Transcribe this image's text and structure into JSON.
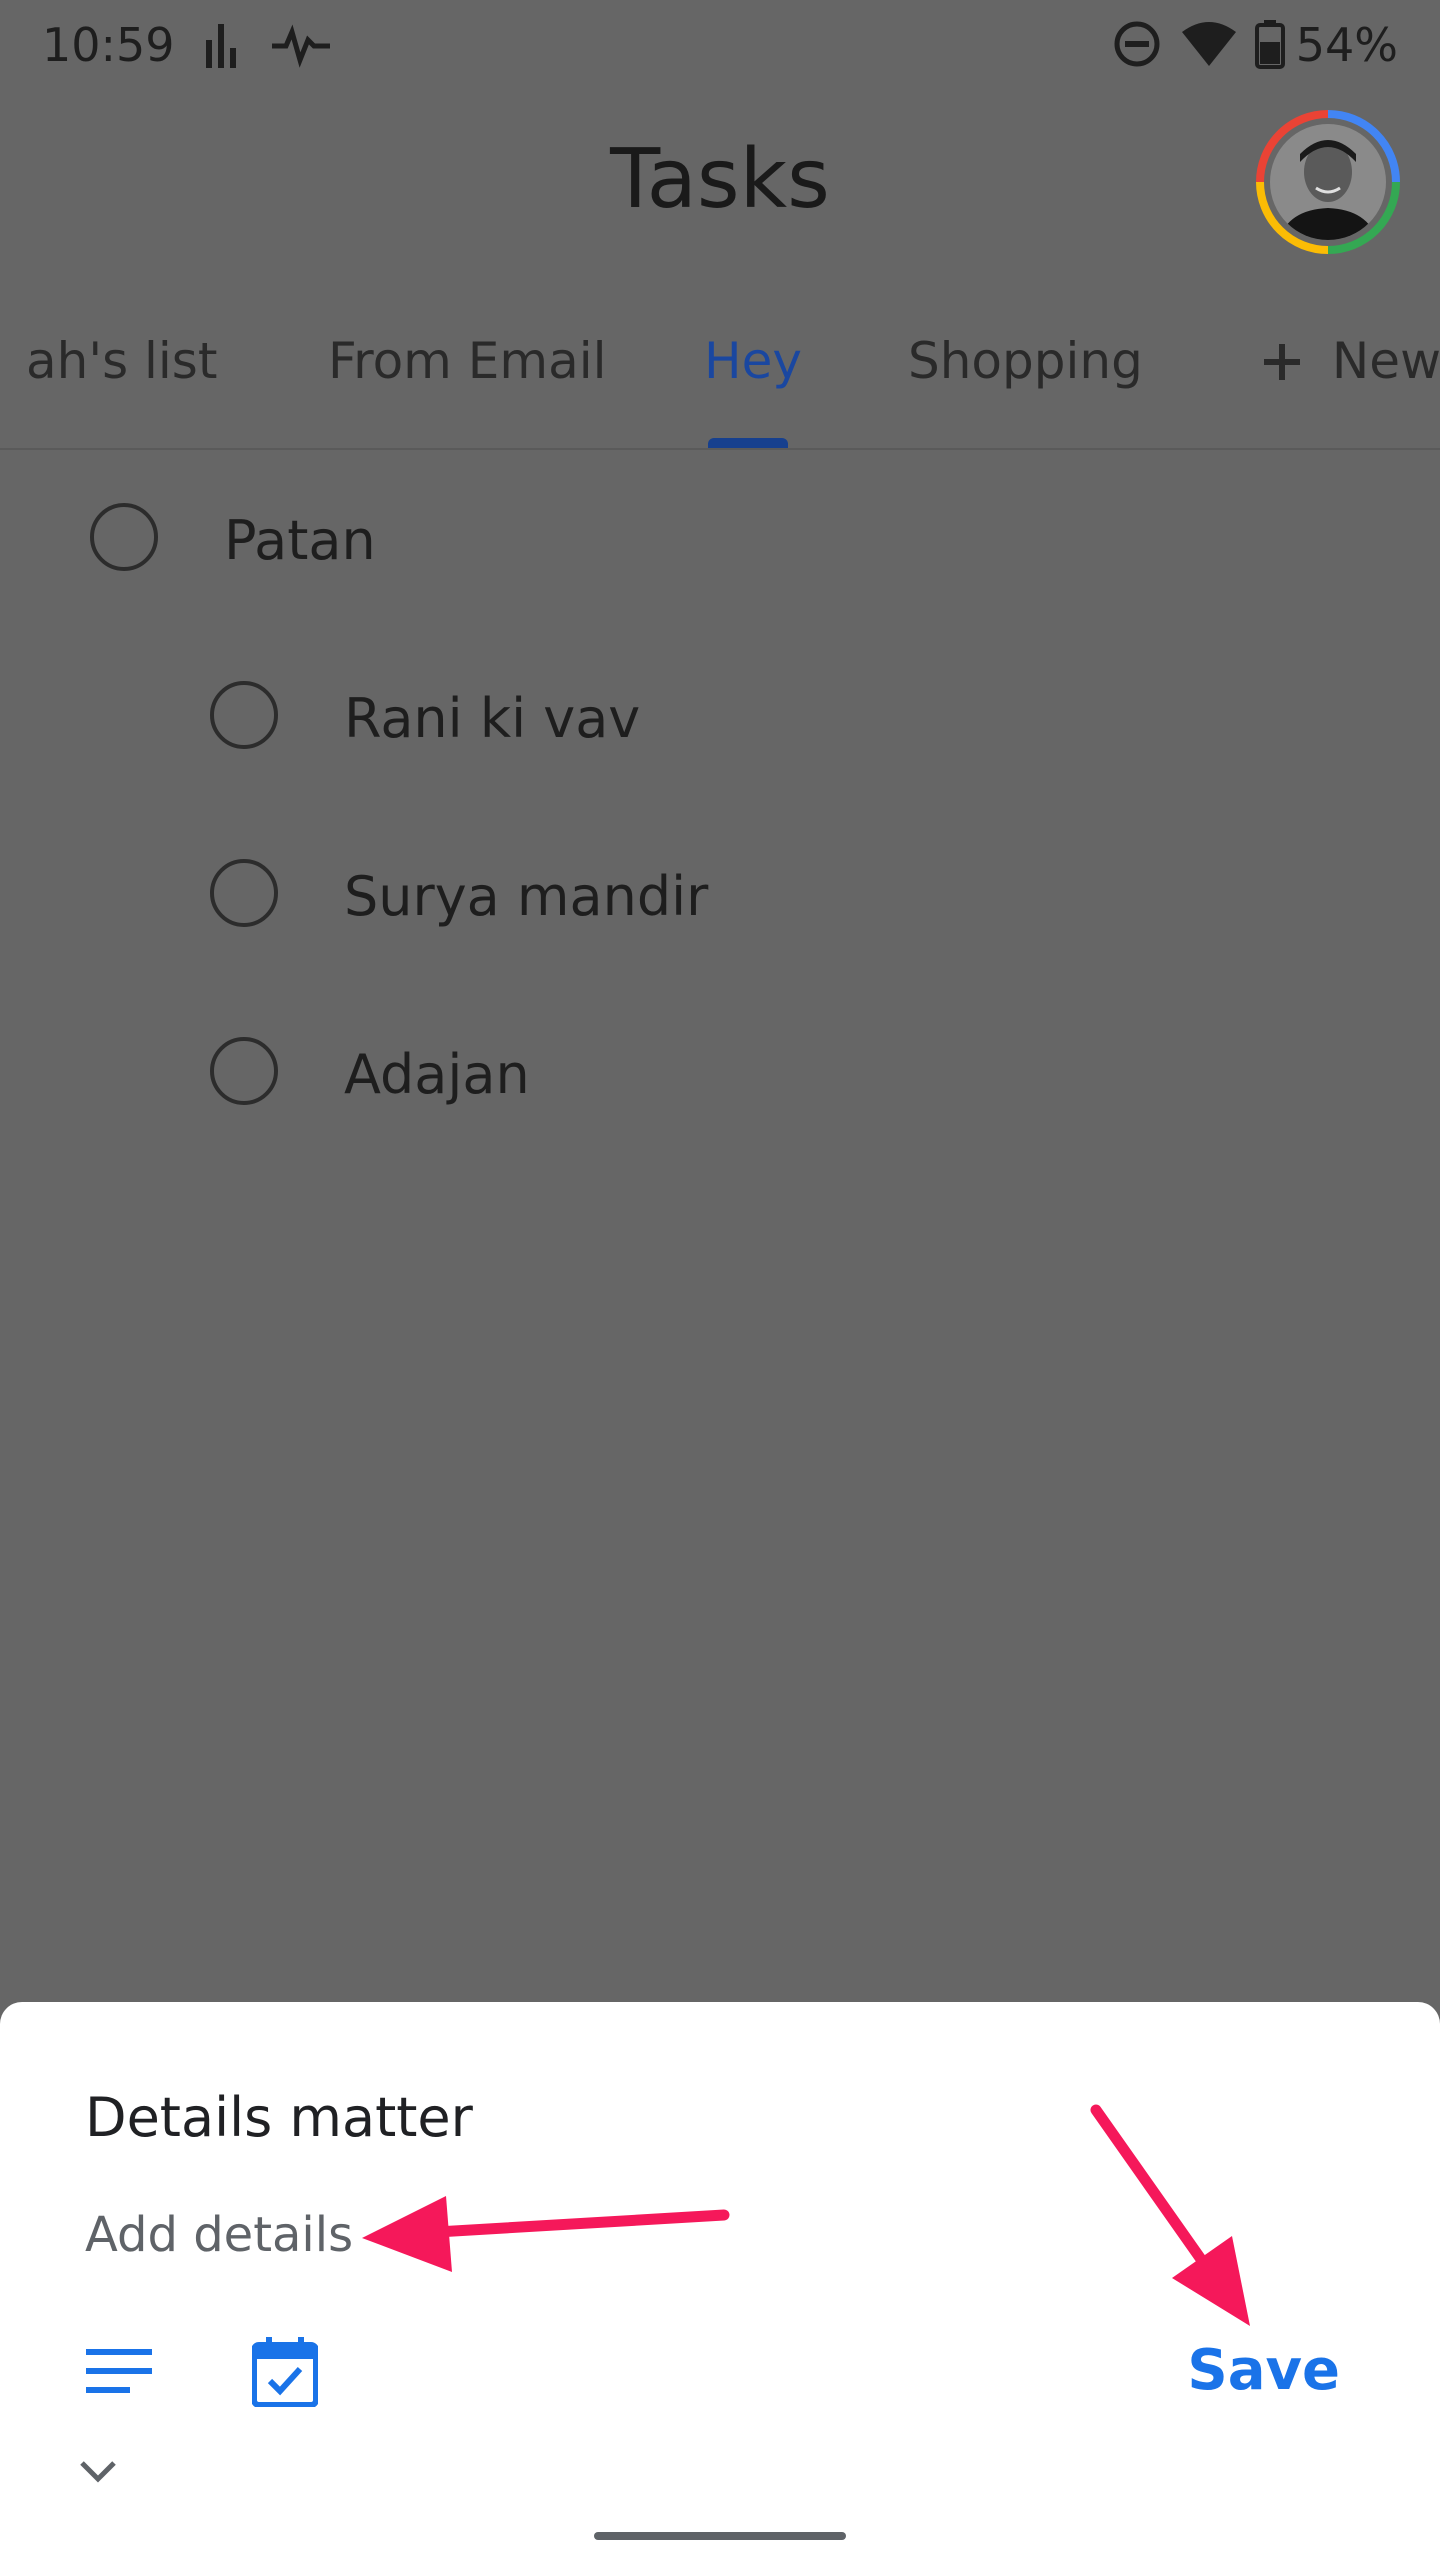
{
  "status_bar": {
    "time": "10:59",
    "battery": "54%",
    "icons": [
      "bar-chart-icon",
      "pulse-icon",
      "do-not-disturb-icon",
      "wifi-icon",
      "battery-icon"
    ]
  },
  "header": {
    "title": "Tasks",
    "avatar_icon": "account-avatar-icon"
  },
  "tabs": [
    {
      "label": "ah's list"
    },
    {
      "label": "From Email"
    },
    {
      "label": "Hey",
      "active": true
    },
    {
      "label": "Shopping"
    },
    {
      "label": "New",
      "icon": "plus-icon"
    }
  ],
  "tasks": [
    {
      "label": "Patan"
    },
    {
      "label": "Rani ki vav"
    },
    {
      "label": "Surya mandir"
    },
    {
      "label": "Adajan"
    }
  ],
  "sheet": {
    "title": "Details matter",
    "details_placeholder": "Add details",
    "save_label": "Save",
    "icons": [
      "notes-icon",
      "calendar-check-icon",
      "chevron-down-icon"
    ]
  },
  "colors": {
    "accent": "#1a73e8",
    "tab_active": "#1a47a0",
    "scrim": "#666666",
    "annotation": "#f5185a"
  }
}
